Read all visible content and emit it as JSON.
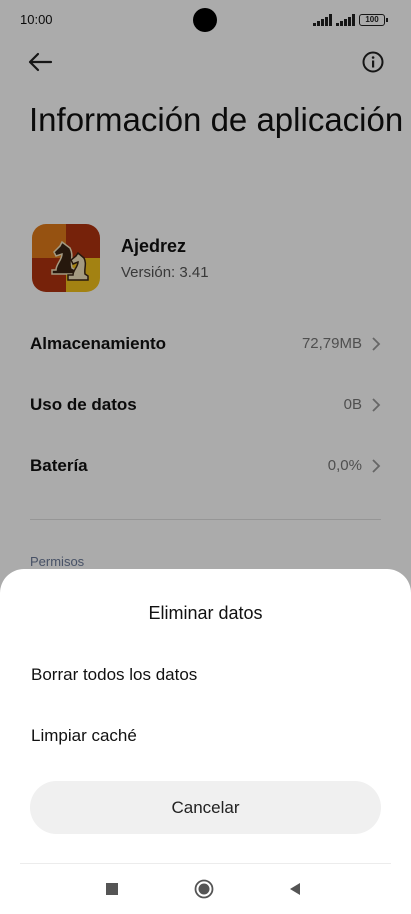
{
  "status_bar": {
    "time": "10:00",
    "battery": "100"
  },
  "header": {
    "back_icon": "arrow-left-icon",
    "info_icon": "info-icon",
    "title": "Información de aplicación"
  },
  "app": {
    "name": "Ajedrez",
    "version": "Versión: 3.41",
    "icon": "chess-knight-icon"
  },
  "settings": [
    {
      "label": "Almacenamiento",
      "value": "72,79MB"
    },
    {
      "label": "Uso de datos",
      "value": "0B"
    },
    {
      "label": "Batería",
      "value": "0,0%"
    }
  ],
  "section": {
    "label": "Permisos"
  },
  "sheet": {
    "title": "Eliminar datos",
    "options": [
      "Borrar todos los datos",
      "Limpiar caché"
    ],
    "cancel_label": "Cancelar"
  },
  "nav": {
    "recents_icon": "square-icon",
    "home_icon": "circle-icon",
    "back_icon": "triangle-back-icon"
  },
  "colors": {
    "scrim": "#000000",
    "sheet": "#ffffff",
    "cancel_bg": "#f0f0f0",
    "app_icon_orange": "#e07b1a",
    "app_icon_red": "#b0330f",
    "app_icon_yellow": "#f3c21b"
  }
}
